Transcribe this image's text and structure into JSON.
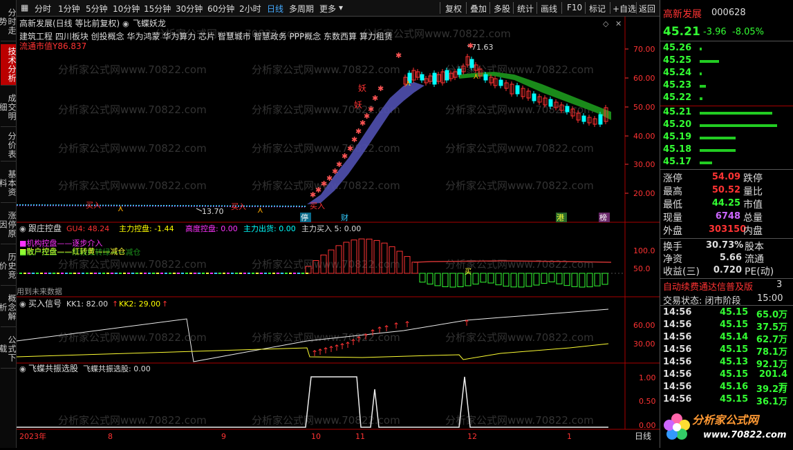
{
  "vtabs": [
    "分时走势",
    "技术分析",
    "成交明细",
    "分价表",
    "基本资料",
    "涨停原因",
    "历史竞价",
    "概念解析",
    "公式下载"
  ],
  "toolbar": {
    "left": [
      "分时",
      "1分钟",
      "5分钟",
      "10分钟",
      "15分钟",
      "30分钟",
      "60分钟",
      "2小时",
      "日线",
      "多周期",
      "更多"
    ],
    "active": "日线",
    "right": [
      "复权",
      "叠加",
      "多股",
      "统计",
      "画线",
      "F10",
      "标记",
      "+自选",
      "返回"
    ]
  },
  "chart_header": {
    "title": "高新发展(日线 等比前复权)",
    "indicator": "飞蝶妖龙",
    "concepts": "建筑工程 四川板块 创投概念 华为鸿蒙 华为算力 芯片 智慧城市 智慧政务 PPP概念 东数西算 算力租赁",
    "market_cap": "流通市值Y86.837",
    "watermark": "分析家公式网www.70822.com"
  },
  "price_axis": [
    "70.00",
    "60.00",
    "50.00",
    "40.00",
    "30.00",
    "20.00"
  ],
  "annotations": {
    "high": "71.63",
    "low": "13.70",
    "buy_label": "买入",
    "demon_label": "妖",
    "halt_badge": "停",
    "fin_badge": "财",
    "hk_badge": "港",
    "list_badge": "榜"
  },
  "panel2": {
    "name": "跟庄控盘",
    "items": [
      {
        "label": "GU4: 48.24",
        "color": "#f33"
      },
      {
        "label": "主力控盘: -1.44",
        "color": "#ff0"
      },
      {
        "label": "高度控盘: 0.00",
        "color": "#f3f"
      },
      {
        "label": "主力出货: 0.00",
        "color": "#0ff"
      },
      {
        "label": "主力买入 5: 0.00",
        "color": "#ddd"
      }
    ],
    "legend1": "■机构控盘——逐步介入",
    "legend2": "■散户控盘——红转黄——减仓",
    "overlay": "■散户控盘——阶段红转绿——减仓",
    "future": "用到未来数据",
    "axis": [
      "100.0",
      "50.0"
    ]
  },
  "panel3": {
    "name": "买入信号",
    "items": [
      {
        "label": "KK1: 82.00",
        "color": "#ddd"
      },
      {
        "label": "KK2: 29.00",
        "color": "#ff0"
      }
    ],
    "axis": [
      "60.00",
      "30.00"
    ],
    "buy_text": "买"
  },
  "panel4": {
    "name": "飞蝶共振选股",
    "items": [
      {
        "label": "飞蝶共振选股: 0.00",
        "color": "#ddd"
      }
    ],
    "axis": [
      "1.00",
      "0.50",
      "0.00"
    ]
  },
  "time_axis": [
    "2023年",
    "8",
    "9",
    "10",
    "11",
    "12",
    "1"
  ],
  "period_label": "日线",
  "quote": {
    "name": "高新发展",
    "code": "000628",
    "price": "45.21",
    "change": "-3.96",
    "pct": "-8.05%",
    "asks": [
      {
        "price": "45.26",
        "w": 3
      },
      {
        "price": "45.25",
        "w": 28
      },
      {
        "price": "45.24",
        "w": 3
      },
      {
        "price": "45.23",
        "w": 9
      },
      {
        "price": "45.22",
        "w": 4
      }
    ],
    "bids": [
      {
        "price": "45.21",
        "w": 105
      },
      {
        "price": "45.20",
        "w": 112
      },
      {
        "price": "45.19",
        "w": 52
      },
      {
        "price": "45.18",
        "w": 52
      },
      {
        "price": "45.17",
        "w": 18
      }
    ],
    "stats": [
      {
        "l1": "涨停",
        "v1": "54.09",
        "c1": "#f33",
        "l2": "跌停",
        "v2": "",
        "c2": "#3f3"
      },
      {
        "l1": "最高",
        "v1": "50.52",
        "c1": "#f33",
        "l2": "量比",
        "v2": "",
        "c2": "#ddd"
      },
      {
        "l1": "最低",
        "v1": "44.25",
        "c1": "#3f3",
        "l2": "市值",
        "v2": "",
        "c2": "#ddd"
      },
      {
        "l1": "现量",
        "v1": "6748",
        "c1": "#c6f",
        "l2": "总量",
        "v2": "",
        "c2": "#ddd"
      },
      {
        "l1": "外盘",
        "v1": "303150",
        "c1": "#f33",
        "l2": "内盘",
        "v2": "",
        "c2": "#ddd"
      }
    ],
    "stats2": [
      {
        "l1": "换手",
        "v1": "30.73%",
        "l2": "股本"
      },
      {
        "l1": "净资",
        "v1": "5.66",
        "l2": "流通"
      },
      {
        "l1": "收益(三)",
        "v1": "0.720",
        "l2": "PE(动)"
      }
    ],
    "promo": "自动续费通达信普及版",
    "promo_num": "3",
    "trade_status": "交易状态: 闭市阶段",
    "trade_time": "15:00",
    "ticks": [
      {
        "t": "14:56",
        "p": "45.15",
        "v": "65.0万"
      },
      {
        "t": "14:56",
        "p": "45.15",
        "v": "37.5万"
      },
      {
        "t": "14:56",
        "p": "45.14",
        "v": "62.7万"
      },
      {
        "t": "14:56",
        "p": "45.15",
        "v": "78.1万"
      },
      {
        "t": "14:56",
        "p": "45.13",
        "v": "92.1万"
      },
      {
        "t": "14:56",
        "p": "45.15",
        "v": "201.4万"
      },
      {
        "t": "14:56",
        "p": "45.16",
        "v": "39.2万"
      },
      {
        "t": "14:56",
        "p": "45.15",
        "v": "36.1万"
      }
    ],
    "logo_text": "分析家公式网",
    "logo_url": "www.70822.com"
  },
  "colors": {
    "up": "#ff3232",
    "down": "#00ffff",
    "ribbon_up": "#5050b0",
    "ribbon_down": "#1a8a1a",
    "price_green": "#3f3"
  }
}
